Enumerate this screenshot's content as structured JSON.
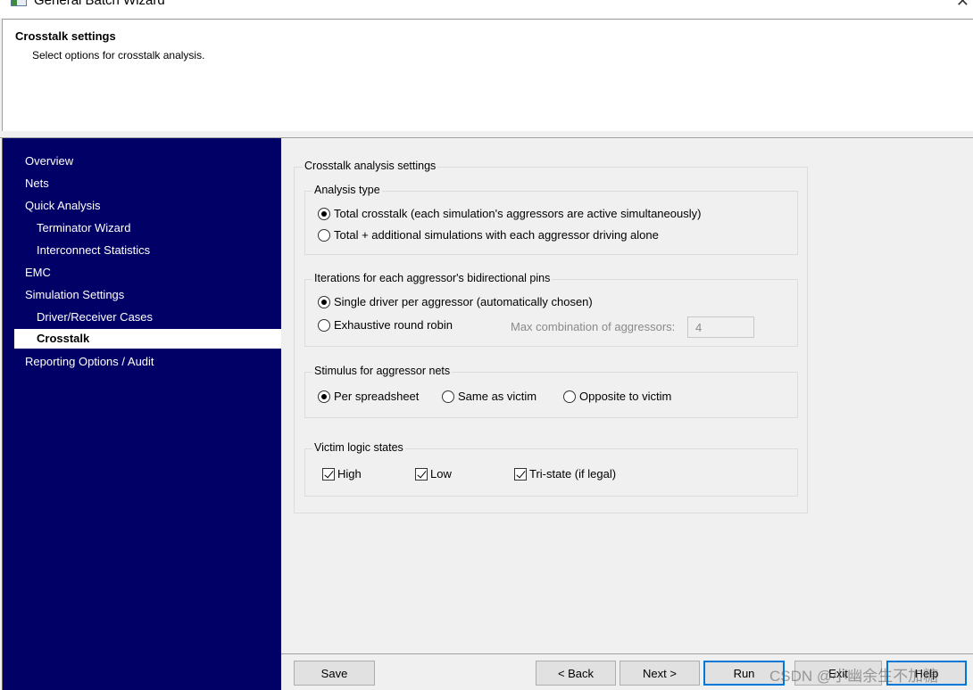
{
  "window": {
    "title": "General Batch Wizard",
    "close_glyph": "✕"
  },
  "header": {
    "title": "Crosstalk settings",
    "subtitle": "Select options for crosstalk analysis."
  },
  "sidebar": {
    "items": [
      {
        "label": "Overview"
      },
      {
        "label": "Nets"
      },
      {
        "label": "Quick Analysis"
      },
      {
        "label": "Terminator Wizard"
      },
      {
        "label": "Interconnect Statistics"
      },
      {
        "label": "EMC"
      },
      {
        "label": "Simulation Settings"
      },
      {
        "label": "Driver/Receiver Cases"
      },
      {
        "label": "Crosstalk",
        "selected": true
      },
      {
        "label": "Reporting Options / Audit"
      }
    ],
    "background": "#000066"
  },
  "settings": {
    "title": "Crosstalk analysis settings",
    "analysis_type": {
      "label": "Analysis type",
      "options": [
        {
          "label": "Total crosstalk (each simulation's aggressors are active simultaneously)",
          "selected": true
        },
        {
          "label": "Total + additional simulations with each aggressor driving alone",
          "selected": false
        }
      ]
    },
    "iterations": {
      "label": "Iterations for each aggressor's bidirectional pins",
      "options": [
        {
          "label": "Single driver per aggressor (automatically chosen)",
          "selected": true
        },
        {
          "label": "Exhaustive round robin",
          "selected": false
        }
      ],
      "max_combination_label": "Max combination of aggressors:",
      "max_combination_value": "4"
    },
    "stimulus": {
      "label": "Stimulus for aggressor nets",
      "options": [
        {
          "label": "Per spreadsheet",
          "selected": true
        },
        {
          "label": "Same as victim",
          "selected": false
        },
        {
          "label": "Opposite to victim",
          "selected": false
        }
      ]
    },
    "victim": {
      "label": "Victim logic states",
      "options": [
        {
          "label": "High",
          "checked": true
        },
        {
          "label": "Low",
          "checked": true
        },
        {
          "label": "Tri-state (if legal)",
          "checked": true
        }
      ]
    }
  },
  "buttons": {
    "save": "Save",
    "back": "< Back",
    "next": "Next >",
    "run": "Run",
    "exit": "Exit",
    "help": "Help"
  },
  "watermark": "CSDN @小幽余生不加糖"
}
